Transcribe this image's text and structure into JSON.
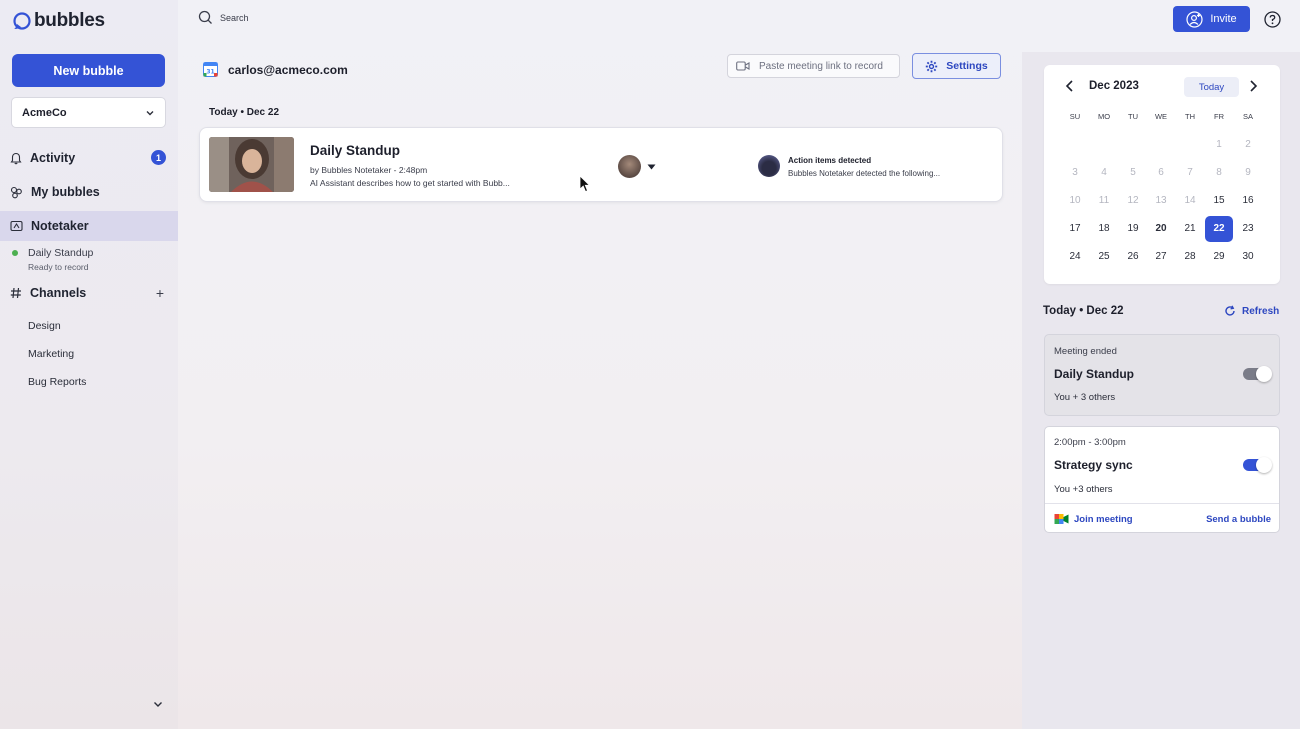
{
  "app": {
    "logo_text": "bubbles"
  },
  "sidebar": {
    "new_bubble_label": "New bubble",
    "org_select": "AcmeCo",
    "activity": {
      "label": "Activity",
      "badge": "1"
    },
    "my_bubbles": "My bubbles",
    "notetaker": "Notetaker",
    "notetaker_item": {
      "title": "Daily Standup",
      "status": "Ready to record"
    },
    "channels": {
      "label": "Channels",
      "items": [
        "Design",
        "Marketing",
        "Bug Reports"
      ]
    }
  },
  "topbar": {
    "search_placeholder": "Search",
    "invite_label": "Invite"
  },
  "main": {
    "account_email": "carlos@acmeco.com",
    "paste_placeholder": "Paste meeting link to record",
    "settings_label": "Settings",
    "section_date": "Today • Dec 22",
    "meeting": {
      "title": "Daily Standup",
      "by": "by Bubbles Notetaker - 2:48pm",
      "description": "AI Assistant describes how to get started with Bubb...",
      "action_title": "Action items detected",
      "action_desc": "Bubbles Notetaker detected the following..."
    }
  },
  "calendar": {
    "month": "Dec 2023",
    "today_label": "Today",
    "weekdays": [
      "SU",
      "MO",
      "TU",
      "WE",
      "TH",
      "FR",
      "SA"
    ],
    "selected_day": "22"
  },
  "right_panel": {
    "date": "Today • Dec 22",
    "refresh_label": "Refresh",
    "events": [
      {
        "meta": "Meeting ended",
        "title": "Daily Standup",
        "others": "You + 3 others",
        "toggle": "on-grey"
      },
      {
        "meta": "2:00pm - 3:00pm",
        "title": "Strategy sync",
        "others": "You +3 others",
        "toggle": "on",
        "join_label": "Join meeting",
        "send_label": "Send a bubble"
      }
    ]
  },
  "colors": {
    "accent": "#3453d6",
    "accent_text": "#2d47c0",
    "online": "#4caf50"
  }
}
